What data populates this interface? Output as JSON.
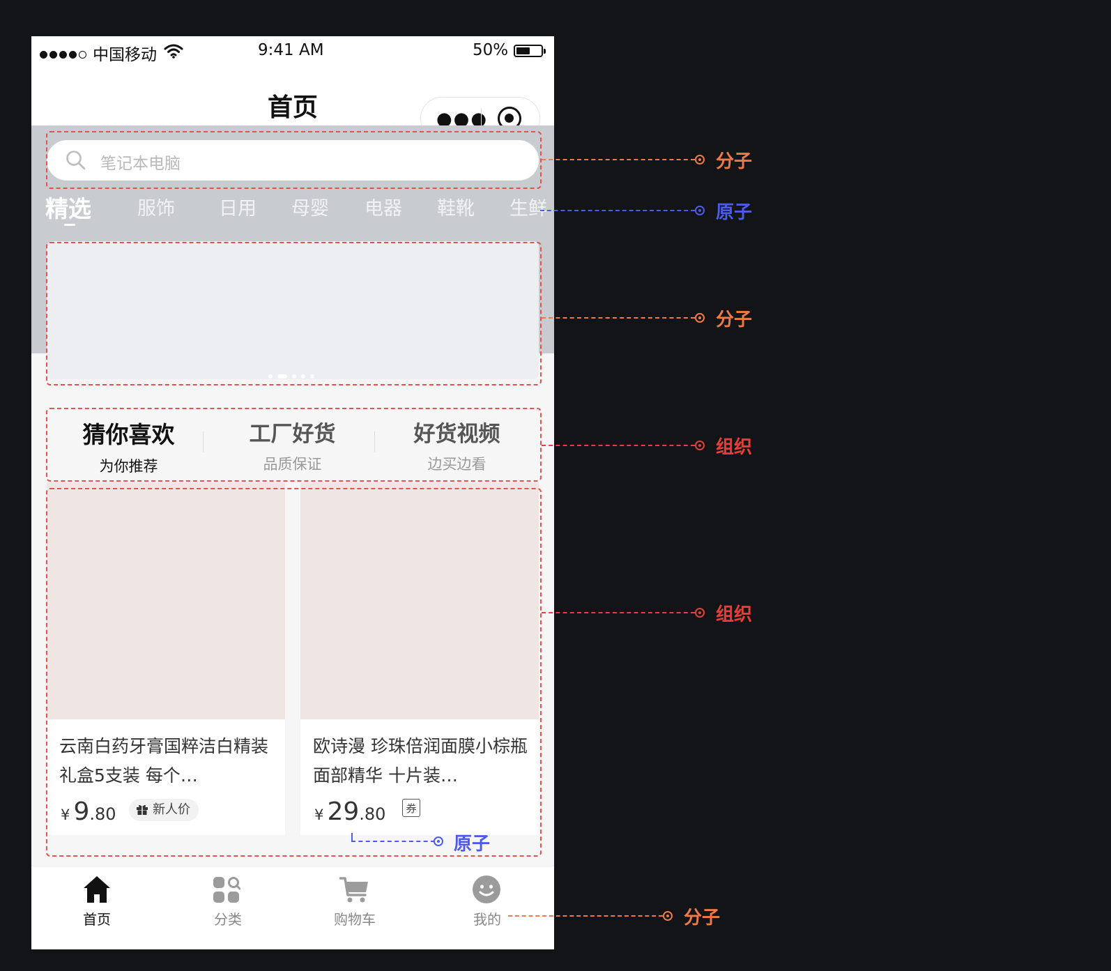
{
  "colors": {
    "molecule": "#ef7a45",
    "atom": "#4d5ce8",
    "organism": "#e53f3a",
    "background": "#121417",
    "product_image": "#efe5e3"
  },
  "status_bar": {
    "carrier": "中国移动",
    "time": "9:41 AM",
    "battery": "50%"
  },
  "nav": {
    "title": "首页",
    "more_icon": "more-dots-icon",
    "record_icon": "target-icon"
  },
  "search": {
    "placeholder": "笔记本电脑",
    "icon": "search-icon"
  },
  "tabs": [
    {
      "label": "精选",
      "active": true
    },
    {
      "label": "服饰"
    },
    {
      "label": "日用"
    },
    {
      "label": "母婴"
    },
    {
      "label": "电器"
    },
    {
      "label": "鞋靴"
    },
    {
      "label": "生鲜"
    }
  ],
  "banner": {
    "slides": 5,
    "current": 2
  },
  "categories": [
    {
      "title": "猜你喜欢",
      "subtitle": "为你推荐",
      "active": true
    },
    {
      "title": "工厂好货",
      "subtitle": "品质保证"
    },
    {
      "title": "好货视频",
      "subtitle": "边买边看"
    }
  ],
  "products": [
    {
      "name": "云南白药牙膏国粹洁白精装礼盒5支装 每个…",
      "currency": "¥",
      "price_int": "9",
      "price_dec": ".80",
      "tag": "新人价",
      "tag_icon": "gift-icon"
    },
    {
      "name": "欧诗漫 珍珠倍润面膜小棕瓶面部精华 十片装…",
      "currency": "¥",
      "price_int": "29",
      "price_dec": ".80",
      "coupon": "券"
    }
  ],
  "tabbar": [
    {
      "label": "首页",
      "icon": "home-icon",
      "active": true
    },
    {
      "label": "分类",
      "icon": "category-icon"
    },
    {
      "label": "购物车",
      "icon": "cart-icon"
    },
    {
      "label": "我的",
      "icon": "smiley-icon"
    }
  ],
  "annotations": {
    "search": "分子",
    "tabs": "原子",
    "banner": "分子",
    "categories": "组织",
    "products": "组织",
    "price": "原子",
    "tabbar": "分子"
  }
}
